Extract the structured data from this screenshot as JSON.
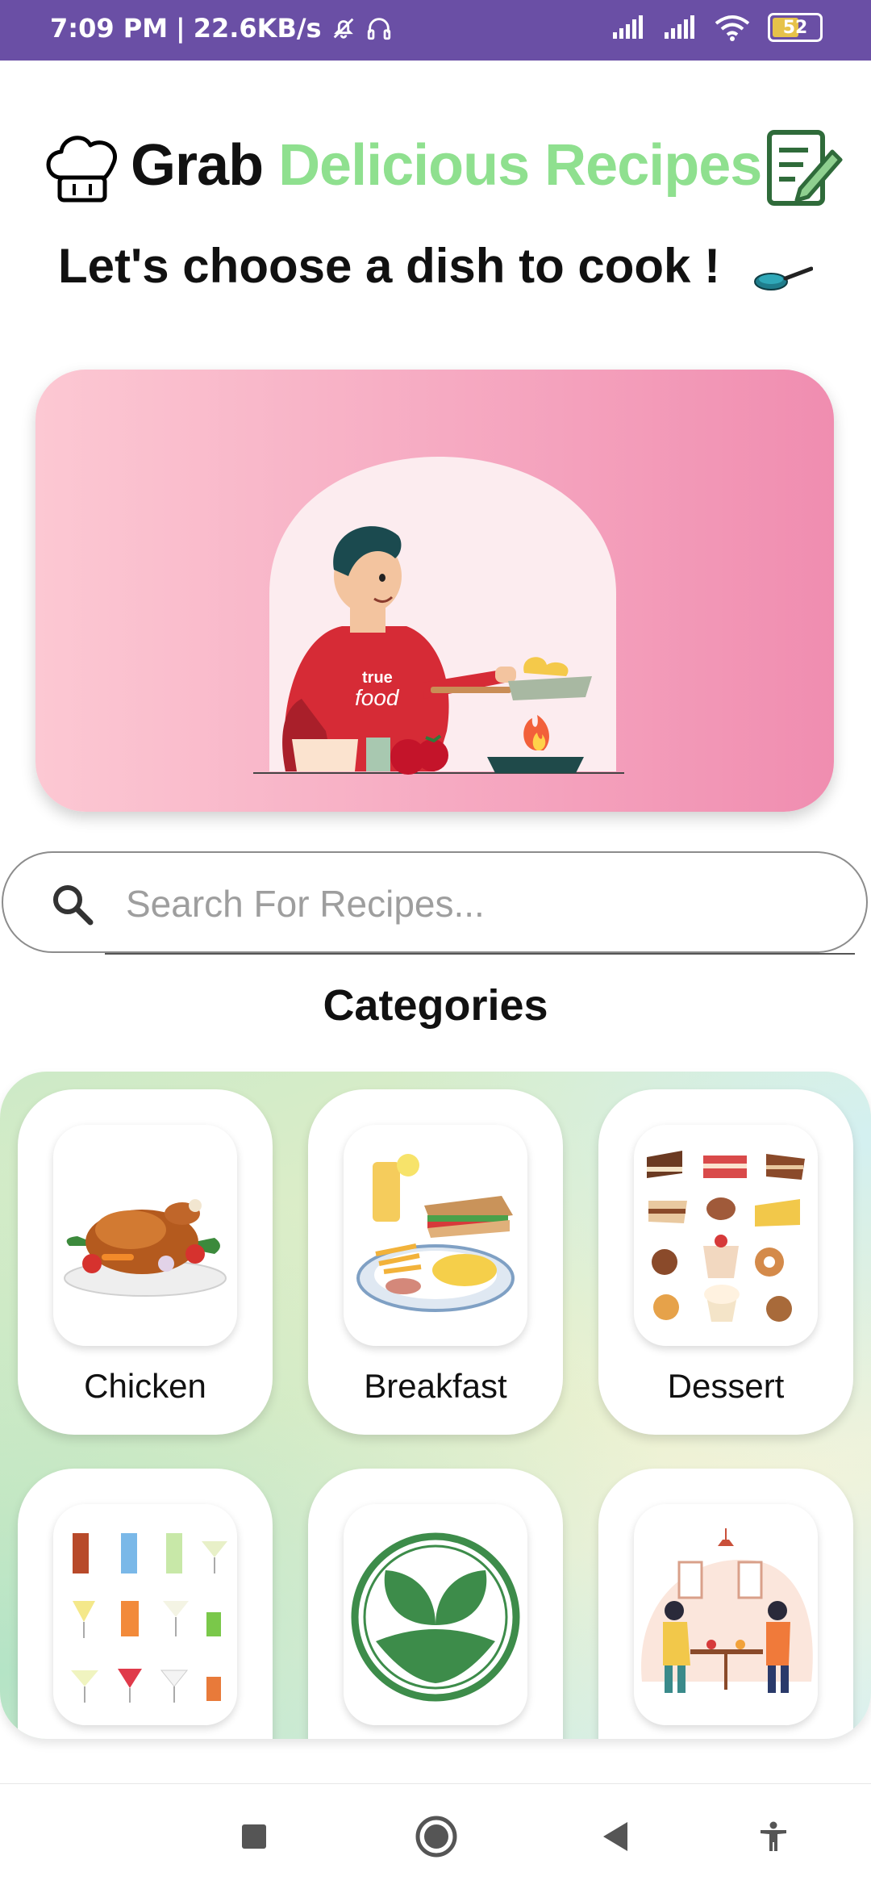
{
  "status_bar": {
    "time": "7:09 PM",
    "separator": "|",
    "network_speed": "22.6KB/s",
    "battery_level": "52",
    "icons": [
      "mute-alarm-icon",
      "headset-icon",
      "signal-icon",
      "signal-icon",
      "wifi-icon",
      "battery-icon"
    ]
  },
  "header": {
    "title_part1": "Grab",
    "title_part2": "Delicious Recipes",
    "subtitle": "Let's choose a dish to cook !",
    "colors": {
      "title_dark": "#111111",
      "title_accent": "#8fe08f"
    }
  },
  "hero": {
    "apron_text_line1": "true",
    "apron_text_line2": "food"
  },
  "search": {
    "placeholder": "Search For Recipes...",
    "value": ""
  },
  "categories": {
    "title": "Categories",
    "items": [
      {
        "label": "Chicken",
        "icon": "roast-chicken-icon"
      },
      {
        "label": "Breakfast",
        "icon": "breakfast-plate-icon"
      },
      {
        "label": "Dessert",
        "icon": "desserts-icon"
      },
      {
        "label": "",
        "icon": "cocktails-icon"
      },
      {
        "label": "",
        "icon": "vegetarian-leaf-icon"
      },
      {
        "label": "",
        "icon": "dining-couple-icon"
      }
    ]
  },
  "nav_bar": {
    "buttons": [
      "recents-square-icon",
      "home-circle-icon",
      "back-triangle-icon",
      "accessibility-icon"
    ]
  },
  "colors": {
    "status_bar": "#6a4fa5",
    "hero_gradient_start": "#fcc8d3",
    "hero_gradient_end": "#f08db0"
  }
}
